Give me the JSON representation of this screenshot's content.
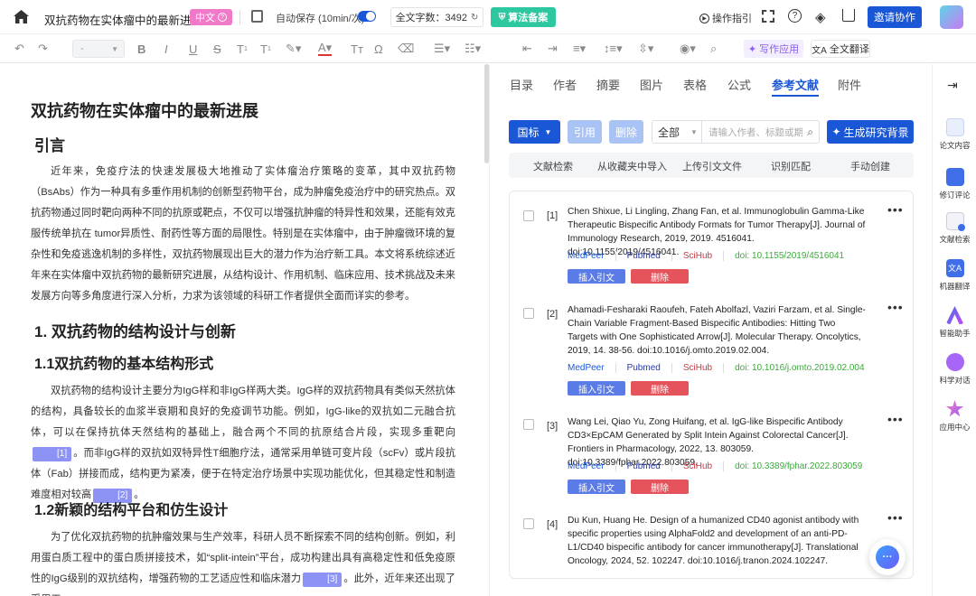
{
  "header": {
    "doc_title": "双抗药物在实体瘤中的最新进展",
    "lang_badge": "中文",
    "autosave": "自动保存 (10min/次)",
    "word_count_label": "全文字数：3492",
    "algo_badge": "算法备案",
    "guide": "操作指引",
    "invite": "邀请协作"
  },
  "toolbar": {
    "style_select": "-",
    "ai_write": "写作应用",
    "translate_full": "全文翻译"
  },
  "doc": {
    "title": "双抗药物在实体瘤中的最新进展",
    "intro_heading": "引言",
    "intro_para": "近年来，免疫疗法的快速发展极大地推动了实体瘤治疗策略的变革，其中双抗药物（BsAbs）作为一种具有多重作用机制的创新型药物平台，成为肿瘤免疫治疗中的研究热点。双抗药物通过同时靶向两种不同的抗原或靶点，不仅可以增强抗肿瘤的特异性和效果，还能有效克服传统单抗在 tumor异质性、耐药性等方面的局限性。特别是在实体瘤中，由于肿瘤微环境的复杂性和免疫逃逸机制的多样性，双抗药物展现出巨大的潜力作为治疗新工具。本文将系统综述近年来在实体瘤中双抗药物的最新研究进展，从结构设计、作用机制、临床应用、技术挑战及未来发展方向等多角度进行深入分析，力求为该领域的科研工作者提供全面而详实的参考。",
    "sec1_heading": "1. 双抗药物的结构设计与创新",
    "sec11_heading": "1.1双抗药物的基本结构形式",
    "sec11_para_a": "双抗药物的结构设计主要分为IgG样和非IgG样两大类。IgG样的双抗药物具有类似天然抗体的结构，具备较长的血浆半衰期和良好的免疫调节功能。例如，IgG-like的双抗如二元融合抗体，可以在保持抗体天然结构的基础上，融合两个不同的抗原结合片段，实现多重靶向",
    "sec11_cite1": "[1]",
    "sec11_para_b": "。而非IgG样的双抗如双特异性T细胞疗法，通常采用单链可变片段（scFv）或片段抗体（Fab）拼接而成，结构更为紧凑，便于在特定治疗场景中实现功能优化，但其稳定性和制造难度相对较高",
    "sec11_cite2": "[2]",
    "sec11_para_c": "。",
    "sec12_heading": "1.2新颖的结构平台和仿生设计",
    "sec12_para_a": "为了优化双抗药物的抗肿瘤效果与生产效率，科研人员不断探索不同的结构创新。例如，利用蛋白质工程中的蛋白质拼接技术，如“split-intein”平台，成功构建出具有高稳定性和低免疫原性的IgG级别的双抗结构，增强药物的工艺适应性和临床潜力",
    "sec12_cite3": "[3]",
    "sec12_para_b": "。此外，近年来还出现了采用工"
  },
  "panel": {
    "tabs": [
      "目录",
      "作者",
      "摘要",
      "图片",
      "表格",
      "公式",
      "参考文献",
      "附件"
    ],
    "active_tab": "参考文献",
    "region": "国标",
    "cite_btn": "引用",
    "delete_btn": "删除",
    "filter_all": "全部",
    "search_placeholder": "请输入作者、标题或期刊",
    "gen_bg": "生成研究背景",
    "subtabs": [
      "文献检索",
      "从收藏夹中导入",
      "上传引文文件",
      "识别匹配",
      "手动创建"
    ],
    "refs": [
      {
        "num": "[1]",
        "text": "Chen Shixue, Li Lingling, Zhang Fan, et al. Immunoglobulin Gamma-Like Therapeutic Bispecific Antibody Formats for Tumor Therapy[J]. Journal of Immunology Research, 2019, 2019. 4516041. doi:10.1155/2019/4516041.",
        "doi": "doi: 10.1155/2019/4516041"
      },
      {
        "num": "[2]",
        "text": "Ahamadi-Fesharaki Raoufeh, Fateh Abolfazl, Vaziri Farzam, et al. Single-Chain Variable Fragment-Based Bispecific Antibodies: Hitting Two Targets with One Sophisticated Arrow[J]. Molecular Therapy. Oncolytics, 2019, 14. 38-56. doi:10.1016/j.omto.2019.02.004.",
        "doi": "doi: 10.1016/j.omto.2019.02.004"
      },
      {
        "num": "[3]",
        "text": "Wang Lei, Qiao Yu, Zong Huifang, et al. IgG-like Bispecific Antibody CD3×EpCAM Generated by Split Intein Against Colorectal Cancer[J]. Frontiers in Pharmacology, 2022, 13. 803059. doi:10.3389/fphar.2022.803059.",
        "doi": "doi: 10.3389/fphar.2022.803059"
      },
      {
        "num": "[4]",
        "text": "Du Kun, Huang He. Design of a humanized CD40 agonist antibody with specific properties using AlphaFold2 and development of an anti-PD-L1/CD40 bispecific antibody for cancer immunotherapy[J]. Translational Oncology, 2024, 52. 102247. doi:10.1016/j.tranon.2024.102247.",
        "doi": ""
      }
    ],
    "link_medpeer": "MedPeer",
    "link_pubmed": "Pubmed",
    "link_scihub": "SciHub",
    "insert_btn": "插入引文",
    "del_btn": "删除"
  },
  "sidebar": {
    "items": [
      "论文内容",
      "修订评论",
      "文献检索",
      "机器翻译",
      "智能助手",
      "科学对话",
      "应用中心"
    ]
  },
  "colors": {
    "primary": "#1a57d6",
    "cite": "#8d93f5",
    "danger": "#e5535d",
    "insert": "#5b7ce6",
    "green": "#3caa3c",
    "pink": "#f07ac8"
  }
}
